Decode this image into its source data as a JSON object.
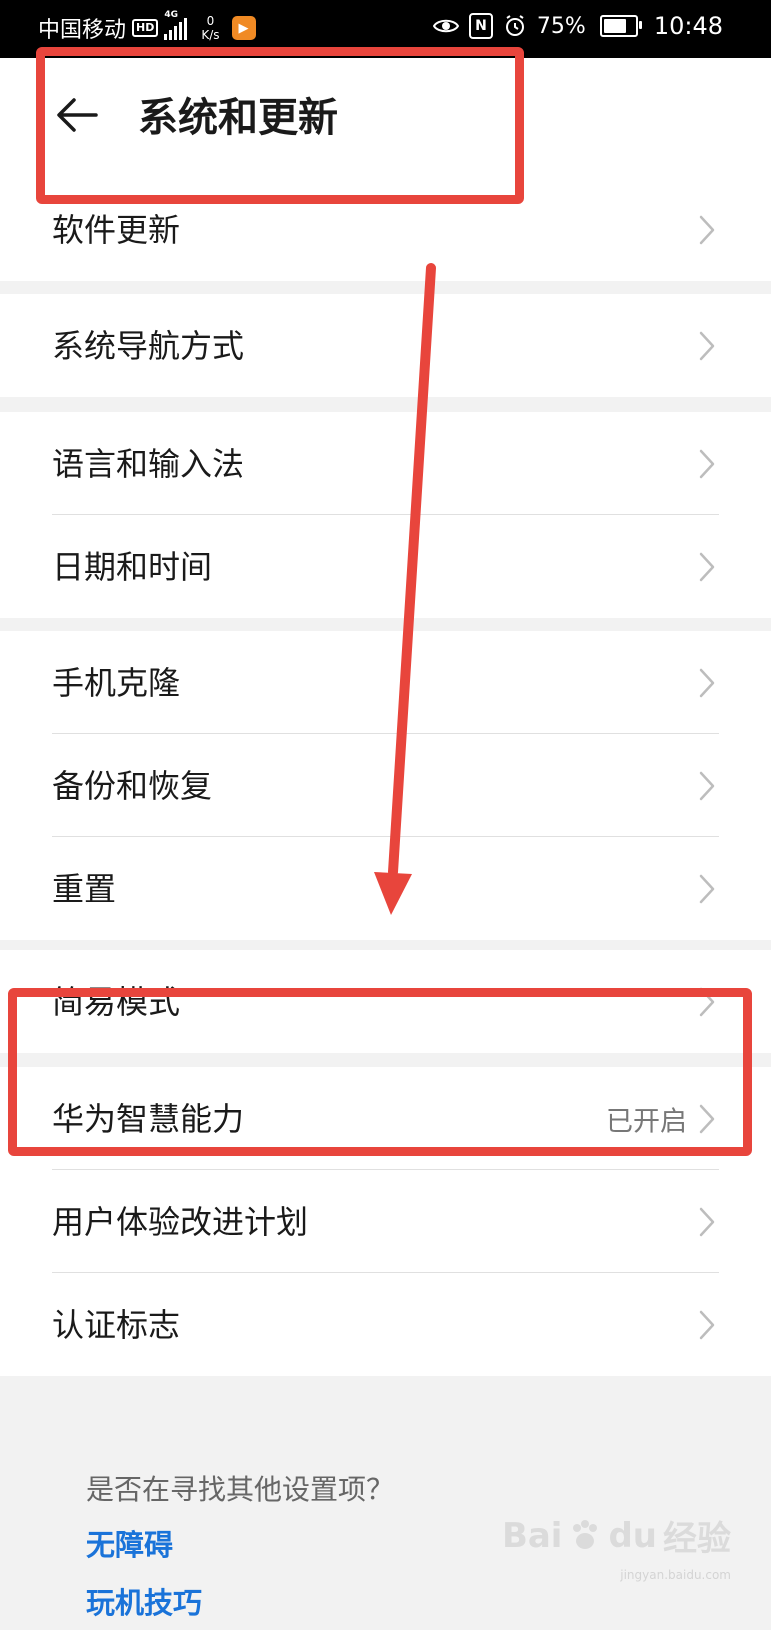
{
  "status_bar": {
    "carrier": "中国移动",
    "hd_badge": "HD",
    "signal_tag": "4G",
    "net_speed_value": "0",
    "net_speed_unit": "K/s",
    "app_badge_icon": "play-icon",
    "battery_percent": "75%",
    "battery_level": 0.75,
    "time": "10:48"
  },
  "header": {
    "title": "系统和更新"
  },
  "groups": [
    [
      {
        "label": "软件更新",
        "value": ""
      }
    ],
    [
      {
        "label": "系统导航方式",
        "value": ""
      }
    ],
    [
      {
        "label": "语言和输入法",
        "value": ""
      },
      {
        "label": "日期和时间",
        "value": ""
      }
    ],
    [
      {
        "label": "手机克隆",
        "value": ""
      },
      {
        "label": "备份和恢复",
        "value": ""
      },
      {
        "label": "重置",
        "value": ""
      }
    ],
    [
      {
        "label": "简易模式",
        "value": ""
      }
    ],
    [
      {
        "label": "华为智慧能力",
        "value": "已开启"
      },
      {
        "label": "用户体验改进计划",
        "value": ""
      },
      {
        "label": "认证标志",
        "value": ""
      }
    ]
  ],
  "suggestions": {
    "question": "是否在寻找其他设置项？",
    "links": [
      "无障碍",
      "玩机技巧"
    ]
  },
  "watermark": {
    "brand": "Bai",
    "brand2": "du",
    "cn": "经验",
    "url": "jingyan.baidu.com"
  },
  "annotation": {
    "color": "#e8453c"
  },
  "accent_color": "#1a73d9"
}
